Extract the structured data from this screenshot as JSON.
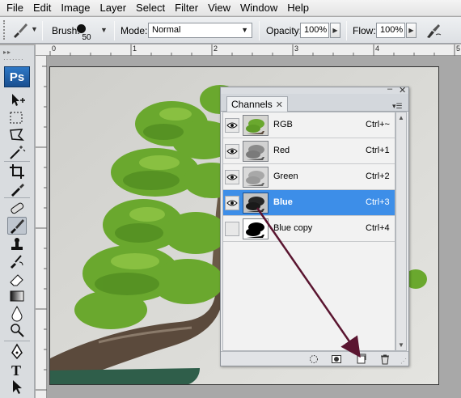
{
  "menu": [
    "File",
    "Edit",
    "Image",
    "Layer",
    "Select",
    "Filter",
    "View",
    "Window",
    "Help"
  ],
  "options": {
    "brush_label": "Brush:",
    "brush_size": "50",
    "mode_label": "Mode:",
    "mode_value": "Normal",
    "opacity_label": "Opacity:",
    "opacity_value": "100%",
    "flow_label": "Flow:",
    "flow_value": "100%"
  },
  "toolbox": {
    "logo": "Ps"
  },
  "ruler": {
    "marks": [
      "0",
      "1",
      "2",
      "3",
      "4",
      "5"
    ]
  },
  "panel": {
    "tab": "Channels",
    "channels": [
      {
        "name": "RGB",
        "shortcut": "Ctrl+~",
        "visible": true,
        "selected": false
      },
      {
        "name": "Red",
        "shortcut": "Ctrl+1",
        "visible": true,
        "selected": false
      },
      {
        "name": "Green",
        "shortcut": "Ctrl+2",
        "visible": true,
        "selected": false
      },
      {
        "name": "Blue",
        "shortcut": "Ctrl+3",
        "visible": true,
        "selected": true
      },
      {
        "name": "Blue copy",
        "shortcut": "Ctrl+4",
        "visible": false,
        "selected": false
      }
    ],
    "footer_icons": [
      "load-channel-as-selection-icon",
      "save-selection-as-channel-icon",
      "new-channel-icon",
      "delete-channel-icon"
    ]
  },
  "colors": {
    "selection": "#3d8ee8",
    "arrow": "#5a1530",
    "ps_logo": "#1f5ea8",
    "foliage": "#6aa82e"
  }
}
